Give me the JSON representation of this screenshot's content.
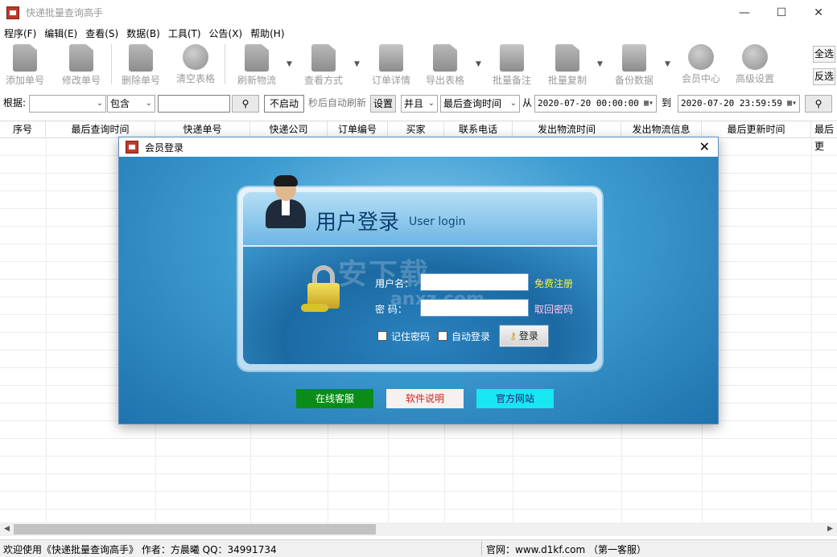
{
  "window": {
    "title": "快递批量查询高手",
    "controls": [
      "—",
      "☐",
      "✕"
    ]
  },
  "menu": [
    "程序(F)",
    "编辑(E)",
    "查看(S)",
    "数据(B)",
    "工具(T)",
    "公告(X)",
    "帮助(H)"
  ],
  "toolbar": {
    "add": "添加单号",
    "edit": "修改单号",
    "delete": "删除单号",
    "clear": "清空表格",
    "refresh": "刷新物流",
    "view_mode": "查看方式",
    "order_detail": "订单详情",
    "export": "导出表格",
    "batch_note": "批量备注",
    "batch_copy": "批量复制",
    "backup": "备份数据",
    "member": "会员中心",
    "advanced": "高级设置",
    "select_all": "全选",
    "invert": "反选"
  },
  "filter": {
    "label": "根据:",
    "field_value": "",
    "op_value": "包含",
    "search_value": "",
    "refresh_state": "不启动",
    "refresh_text": "秒后自动刷新",
    "settings": "设置",
    "logic": "并且",
    "time_field": "最后查询时间",
    "from_label": "从",
    "from_value": "2020-07-20 00:00:00",
    "to_label": "到",
    "to_value": "2020-07-20 23:59:59"
  },
  "columns": [
    "序号",
    "最后查询时间",
    "快递单号",
    "快递公司",
    "订单编号",
    "买家",
    "联系电话",
    "发出物流时间",
    "发出物流信息",
    "最后更新时间",
    "最后更"
  ],
  "status": {
    "welcome": "欢迎使用《快递批量查询高手》 作者：方晨曦  QQ：34991734",
    "site": "官网：www.d1kf.com （第一客服）"
  },
  "dialog": {
    "title": "会员登录",
    "heading": "用户登录",
    "subheading": "User login",
    "username_label": "用户名：",
    "password_label": "密  码：",
    "username_value": "",
    "password_value": "",
    "register_link": "免费注册",
    "retrieve_link": "取回密码",
    "remember": "记住密码",
    "auto_login": "自动登录",
    "login_button": "登录",
    "online_service": "在线客服",
    "software_help": "软件说明",
    "official_site": "官方网站"
  },
  "watermark": {
    "line1": "安下载",
    "line2": "anxz.com"
  },
  "colors": {
    "online_service": "#0b8c18",
    "software_help_text": "#d71c1c",
    "official_site": "#19e6f3",
    "register_link": "#ffef3a"
  }
}
